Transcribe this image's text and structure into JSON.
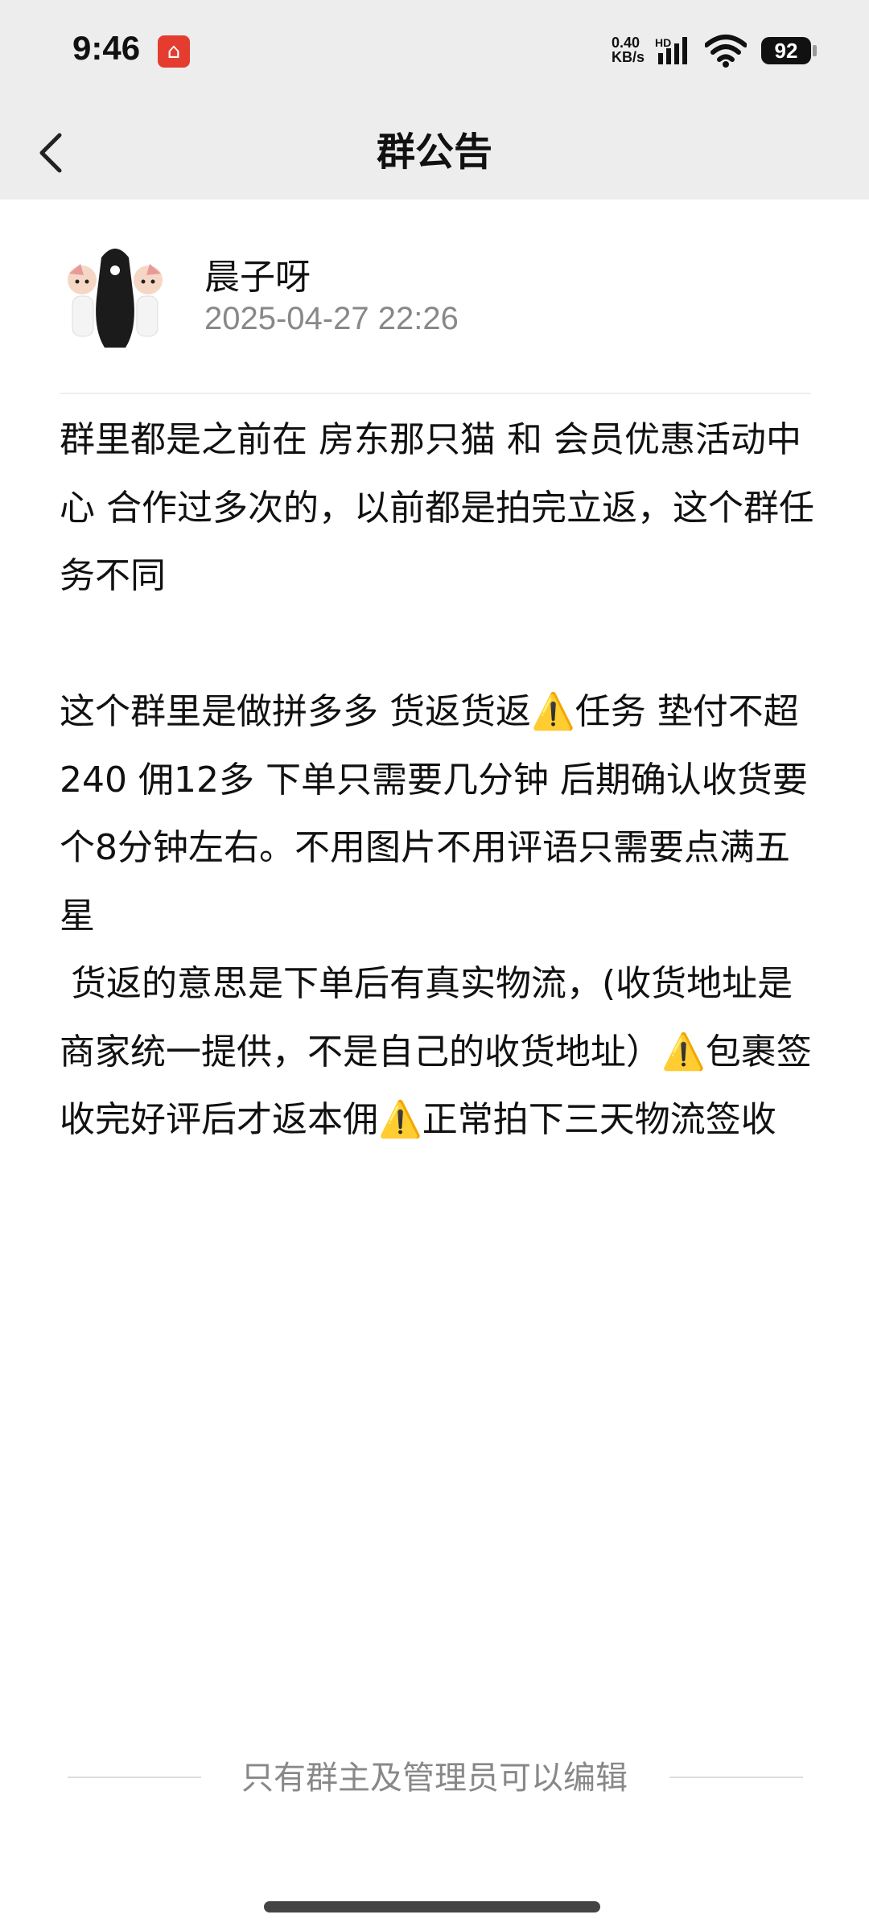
{
  "status_bar": {
    "time": "9:46",
    "app_badge_icon": "app-logo-icon",
    "net_speed_value": "0.40",
    "net_speed_unit": "KB/s",
    "network_label": "HD",
    "battery": "92"
  },
  "nav": {
    "title": "群公告",
    "back_icon": "chevron-left-icon"
  },
  "announcement": {
    "author_name": "晨子呀",
    "datetime": "2025-04-27 22:26",
    "body": "群里都是之前在 房东那只猫 和 会员优惠活动中心 合作过多次的，以前都是拍完立返，这个群任务不同\n\n这个群里是做拼多多 货返货返⚠️任务 垫付不超240 佣12多 下单只需要几分钟 后期确认收货要个8分钟左右。不用图片不用评语只需要点满五星\n 货返的意思是下单后有真实物流，(收货地址是商家统一提供，不是自己的收货地址）⚠️包裹签收完好评后才返本佣⚠️正常拍下三天物流签收"
  },
  "footer": {
    "note": "只有群主及管理员可以编辑"
  },
  "colors": {
    "header_bg": "#ededed",
    "secondary_text": "#888888",
    "app_badge": "#e43d2f"
  }
}
